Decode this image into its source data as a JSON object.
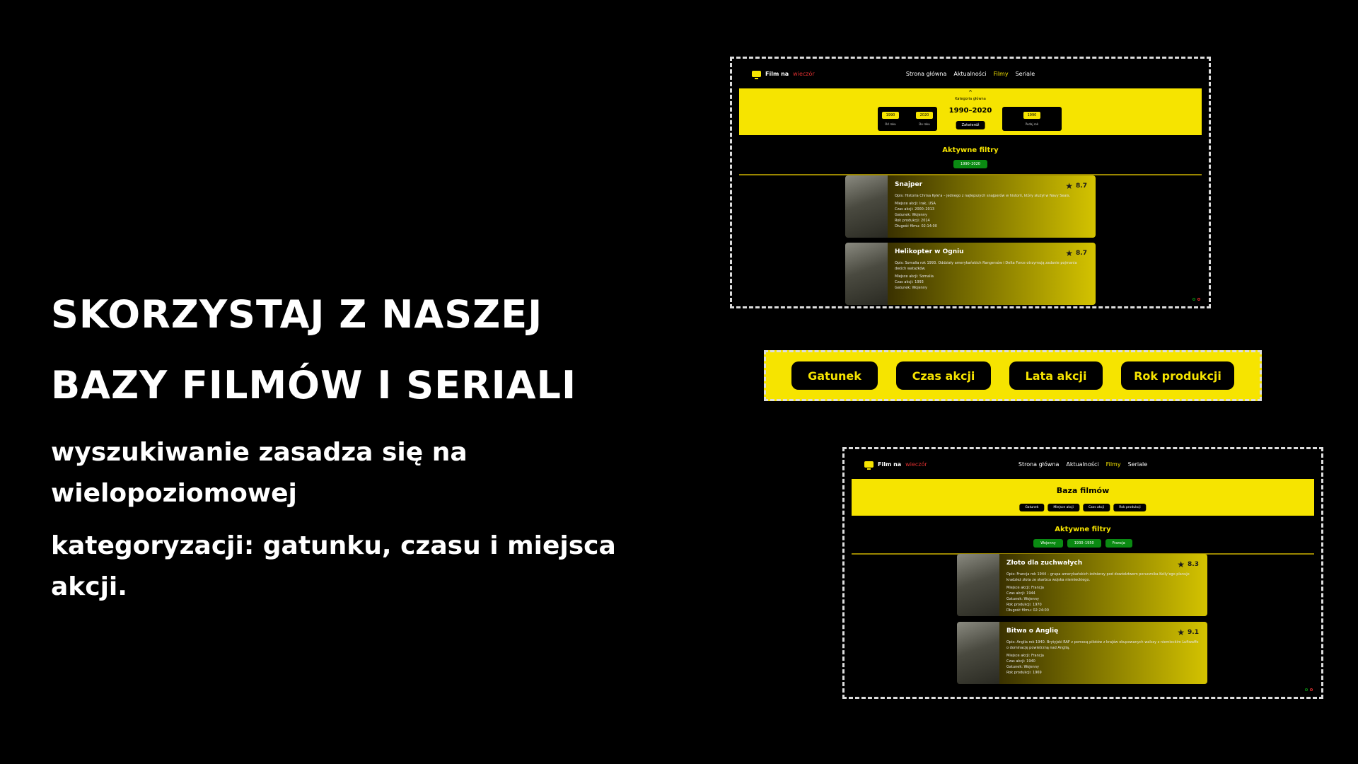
{
  "hero": {
    "heading_line1": "Skorzystaj z naszej",
    "heading_line2": "bazy filmów i seriali",
    "subtitle_line1": "wyszukiwanie zasadza się na wielopoziomowej",
    "subtitle_line2": "kategoryzacji: gatunku, czasu i miejsca akcji."
  },
  "brand": {
    "name": "Film na",
    "accent": "wieczór"
  },
  "nav": {
    "home": "Strona główna",
    "news": "Aktualności",
    "movies": "Filmy",
    "series": "Seriale"
  },
  "shot1": {
    "category_label": "Kategoria główna",
    "range": "1990–2020",
    "approve": "Zatwierdź",
    "year_from": "1990",
    "year_from_label": "Od roku",
    "year_to": "2020",
    "year_to_label": "Do roku",
    "single_year": "1990",
    "single_year_label": "Podaj rok",
    "filters_title": "Aktywne filtry",
    "active_filters": [
      "1990–2020"
    ],
    "movies": [
      {
        "title": "Snajper",
        "rating": "8.7",
        "desc": "Opis: Historia Chrisa Kyle'a – jednego z najlepszych snajperów w historii, który służył w Navy Seals.",
        "fields": [
          "Miejsce akcji: Irak, USA",
          "Czas akcji: 2000–2013",
          "Gatunek: Wojenny",
          "Rok produkcji: 2014",
          "Długość filmu: 02:14:00"
        ]
      },
      {
        "title": "Helikopter w Ogniu",
        "rating": "8.7",
        "desc": "Opis: Somalia rok 1993. Oddziały amerykańskich Rangersów i Delta Force otrzymują zadanie pojmania dwóch watażków.",
        "fields": [
          "Miejsce akcji: Somalia",
          "Czas akcji: 1993",
          "Gatunek: Wojenny"
        ]
      }
    ]
  },
  "categories": [
    "Gatunek",
    "Czas akcji",
    "Lata akcji",
    "Rok produkcji"
  ],
  "shot2": {
    "page_title": "Baza filmów",
    "panel_buttons": [
      "Gatunek",
      "Miejsce akcji",
      "Czas akcji",
      "Rok produkcji"
    ],
    "filters_title": "Aktywne filtry",
    "active_filters": [
      "Wojenny",
      "1930–1950",
      "Francja"
    ],
    "movies": [
      {
        "title": "Złoto dla zuchwałych",
        "rating": "8.3",
        "desc": "Opis: Francja rok 1944 – grupa amerykańskich żołnierzy pod dowództwem porucznika Kelly'ego planuje kradzież złota ze skarbca wojska niemieckiego.",
        "fields": [
          "Miejsce akcji: Francja",
          "Czas akcji: 1944",
          "Gatunek: Wojenny",
          "Rok produkcji: 1970",
          "Długość filmu: 02:24:00"
        ]
      },
      {
        "title": "Bitwa o Anglię",
        "rating": "9.1",
        "desc": "Opis: Anglia rok 1940. Brytyjski RAF z pomocą pilotów z krajów okupowanych walczy z niemieckim Luftwaffe o dominację powietrzną nad Anglią.",
        "fields": [
          "Miejsce akcji: Francja",
          "Czas akcji: 1940",
          "Gatunek: Wojenny",
          "Rok produkcji: 1969"
        ]
      }
    ]
  },
  "colors": {
    "brand_yellow": "#f6e400",
    "filter_green": "#0a8a12",
    "accent_red": "#e03030"
  }
}
